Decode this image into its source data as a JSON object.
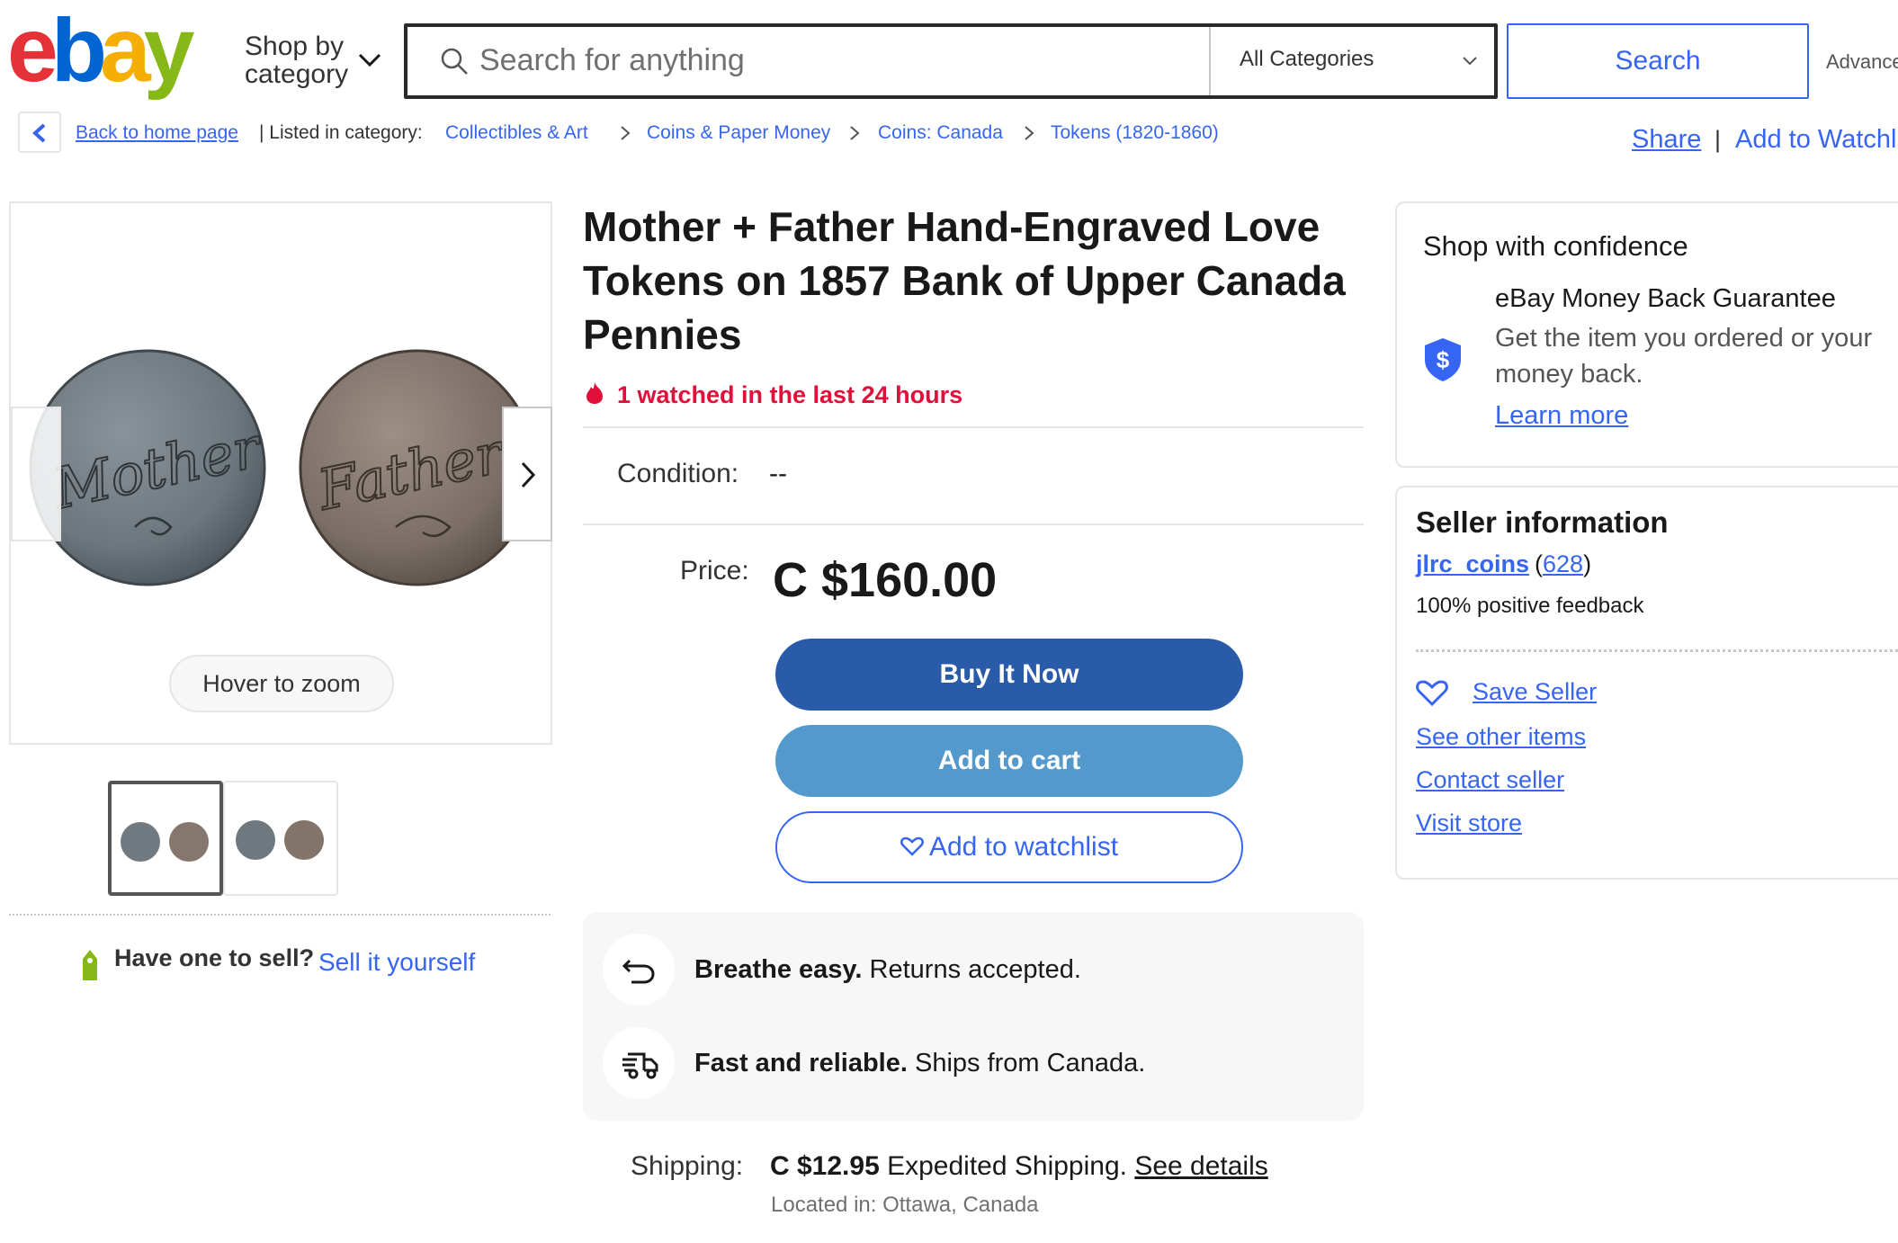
{
  "header": {
    "logo_text": "ebay",
    "shop_by_line1": "Shop by",
    "shop_by_line2": "category",
    "search_placeholder": "Search for anything",
    "category_selected": "All Categories",
    "search_button": "Search",
    "advanced": "Advanced"
  },
  "breadcrumb": {
    "back": "Back to home page",
    "listed_in": "| Listed in category:",
    "items": [
      "Collectibles & Art",
      "Coins & Paper Money",
      "Coins: Canada",
      "Tokens (1820-1860)"
    ],
    "share": "Share",
    "separator": "|",
    "add_to_watchlist": "Add to Watchlist"
  },
  "gallery": {
    "coin1_text": "Mother",
    "coin2_text": "Father",
    "zoom_hint": "Hover to zoom",
    "thumbnail_count": 2
  },
  "sell": {
    "prompt": "Have one to sell?",
    "link": "Sell it yourself"
  },
  "item": {
    "title": "Mother + Father Hand-Engraved Love Tokens on 1857 Bank of Upper Canada Pennies",
    "watched": "1 watched in the last 24 hours",
    "condition_label": "Condition:",
    "condition_value": "--",
    "price_label": "Price:",
    "price": "C $160.00",
    "buy_now": "Buy It Now",
    "add_to_cart": "Add to cart",
    "add_to_watchlist": "Add to watchlist",
    "perk1_bold": "Breathe easy.",
    "perk1_text": " Returns accepted.",
    "perk2_bold": "Fast and reliable.",
    "perk2_text": " Ships from Canada.",
    "shipping_label": "Shipping:",
    "shipping_price": "C $12.95",
    "shipping_method": " Expedited Shipping. ",
    "shipping_details": "See details",
    "located": "Located in: Ottawa, Canada"
  },
  "confidence": {
    "title": "Shop with confidence",
    "guarantee_title": "eBay Money Back Guarantee",
    "guarantee_desc": "Get the item you ordered or your money back.",
    "learn_more": "Learn more"
  },
  "seller": {
    "title": "Seller information",
    "name": "jlrc_coins",
    "feedback_count_prefix": "(",
    "feedback_count": "628",
    "feedback_count_suffix": ")",
    "positive": "100% positive feedback",
    "save_seller": "Save Seller",
    "see_other": "See other items",
    "contact": "Contact seller",
    "visit_store": "Visit store"
  },
  "colors": {
    "brand_blue": "#3665f3",
    "buy_now": "#2a5ba8",
    "add_to_cart": "#5499cb",
    "alert_red": "#e0103a",
    "logo_red": "#e53238",
    "logo_blue": "#0064d2",
    "logo_yellow": "#f5af02",
    "logo_green": "#86b817"
  }
}
